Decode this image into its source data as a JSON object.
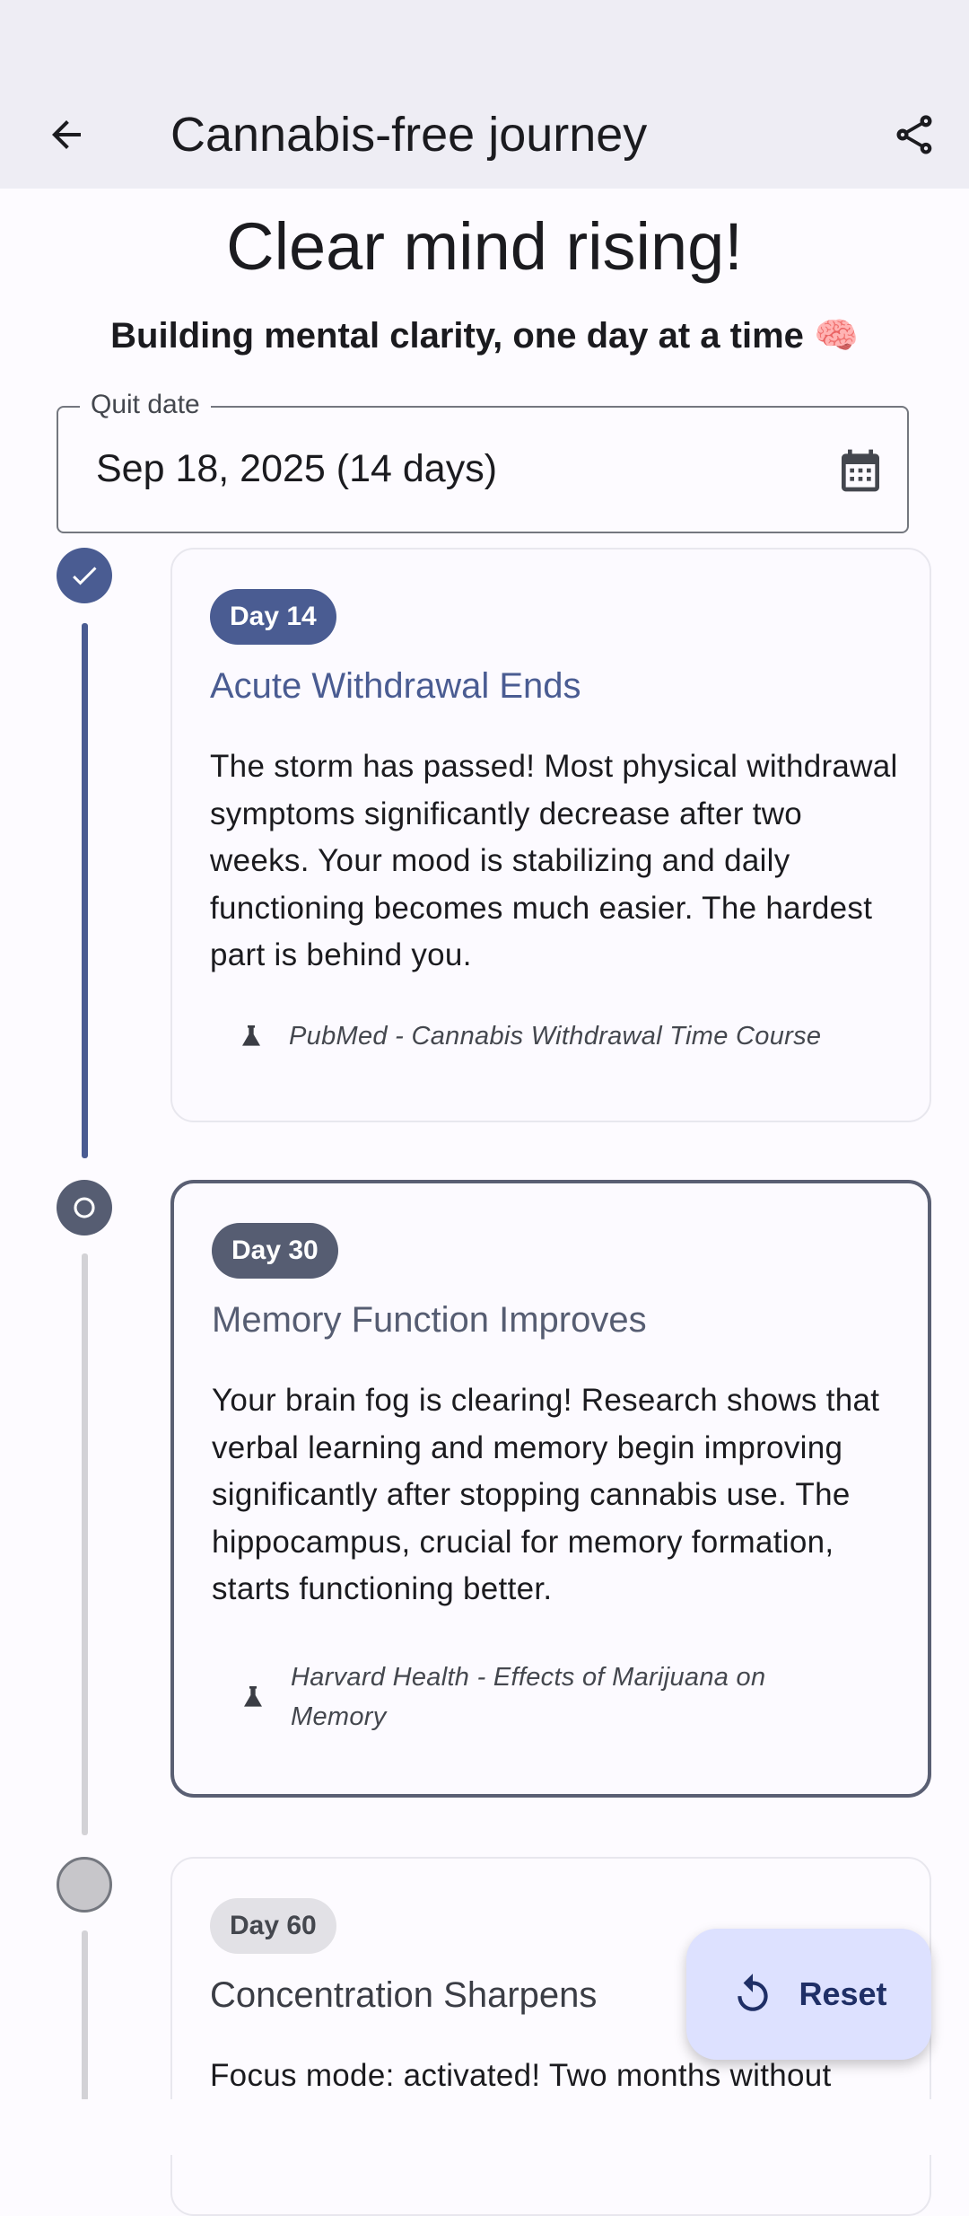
{
  "app_bar": {
    "title": "Cannabis-free journey",
    "back_icon": "arrow-back-icon",
    "share_icon": "share-icon"
  },
  "header": {
    "headline": "Clear mind rising!",
    "subheadline": "Building mental clarity, one day at a time 🧠"
  },
  "quit_date": {
    "label": "Quit date",
    "value": "Sep 18, 2025 (14 days)",
    "icon": "calendar-icon"
  },
  "milestones": [
    {
      "state": "completed",
      "day": "Day 14",
      "title": "Acute Withdrawal Ends",
      "body": "The storm has passed! Most physical withdrawal symptoms significantly decrease after two weeks. Your mood is stabilizing and daily functioning becomes much easier. The hardest part is behind you.",
      "source": "PubMed - Cannabis Withdrawal Time Course"
    },
    {
      "state": "current",
      "day": "Day 30",
      "title": "Memory Function Improves",
      "body": "Your brain fog is clearing! Research shows that verbal learning and memory begin improving significantly after stopping cannabis use. The hippocampus, crucial for memory formation, starts functioning better.",
      "source": "Harvard Health - Effects of Marijuana on Memory"
    },
    {
      "state": "upcoming",
      "day": "Day 60",
      "title": "Concentration Sharpens",
      "body": "Focus mode: activated! Two months without"
    }
  ],
  "fab": {
    "label": "Reset",
    "icon": "reset-icon"
  },
  "colors": {
    "primary": "#4a5c92",
    "current": "#565d72",
    "surface": "#fdfbff",
    "app_bar": "#eeedf4",
    "fab": "#dde1ff"
  }
}
